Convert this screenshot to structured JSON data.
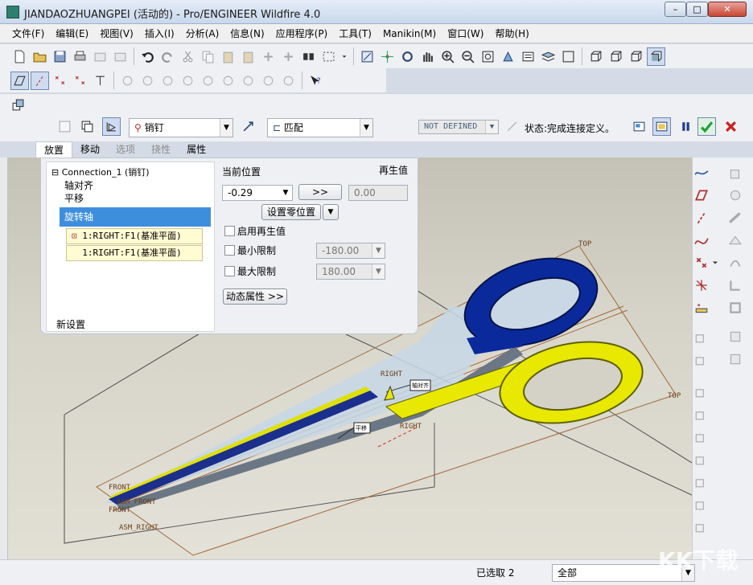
{
  "window": {
    "title": "JIANDAOZHUANGPEI (活动的) - Pro/ENGINEER Wildfire 4.0"
  },
  "menu": [
    "文件(F)",
    "编辑(E)",
    "视图(V)",
    "插入(I)",
    "分析(A)",
    "信息(N)",
    "应用程序(P)",
    "工具(T)",
    "Manikin(M)",
    "窗口(W)",
    "帮助(H)"
  ],
  "dashboard": {
    "connection_type": "销钉",
    "constraint_type": "匹配",
    "status_combo": "NOT DEFINED",
    "status_text": "状态:完成连接定义。"
  },
  "tabs": [
    "放置",
    "移动",
    "选项",
    "挠性",
    "属性"
  ],
  "placement": {
    "tree_root": "Connection_1 (销钉)",
    "items": [
      "轴对齐",
      "平移",
      "旋转轴"
    ],
    "refs": [
      "1:RIGHT:F1(基准平面)",
      "1:RIGHT:F1(基准平面)"
    ],
    "new_set": "新设置",
    "current_position_label": "当前位置",
    "regen_label": "再生值",
    "current_value": "-0.29",
    "arrow_btn": ">>",
    "regen_value": "0.00",
    "set_zero_btn": "设置零位置",
    "enable_regen": "启用再生值",
    "min_limit": "最小限制",
    "min_value": "-180.00",
    "max_limit": "最大限制",
    "max_value": "180.00",
    "dynamic_props": "动态属性 >>"
  },
  "viewport_labels": {
    "top1": "TOP",
    "top2": "TOP",
    "right1": "RIGHT",
    "right2": "RIGHT",
    "front1": "FRONT",
    "front2": "FRONT",
    "asm_front": "ASM_FRONT",
    "asm_right": "ASM_RIGHT",
    "tag1": "轴对齐",
    "tag2": "平移"
  },
  "status": {
    "selected": "已选取 2",
    "filter": "全部"
  },
  "watermark": "KK下载",
  "colors": {
    "handle_blue": "#0a2a9c",
    "handle_yellow": "#e8e800",
    "selection_blue": "#3e8ede",
    "confirm_green": "#1f9d3a",
    "cancel_red": "#cc1f1f"
  }
}
